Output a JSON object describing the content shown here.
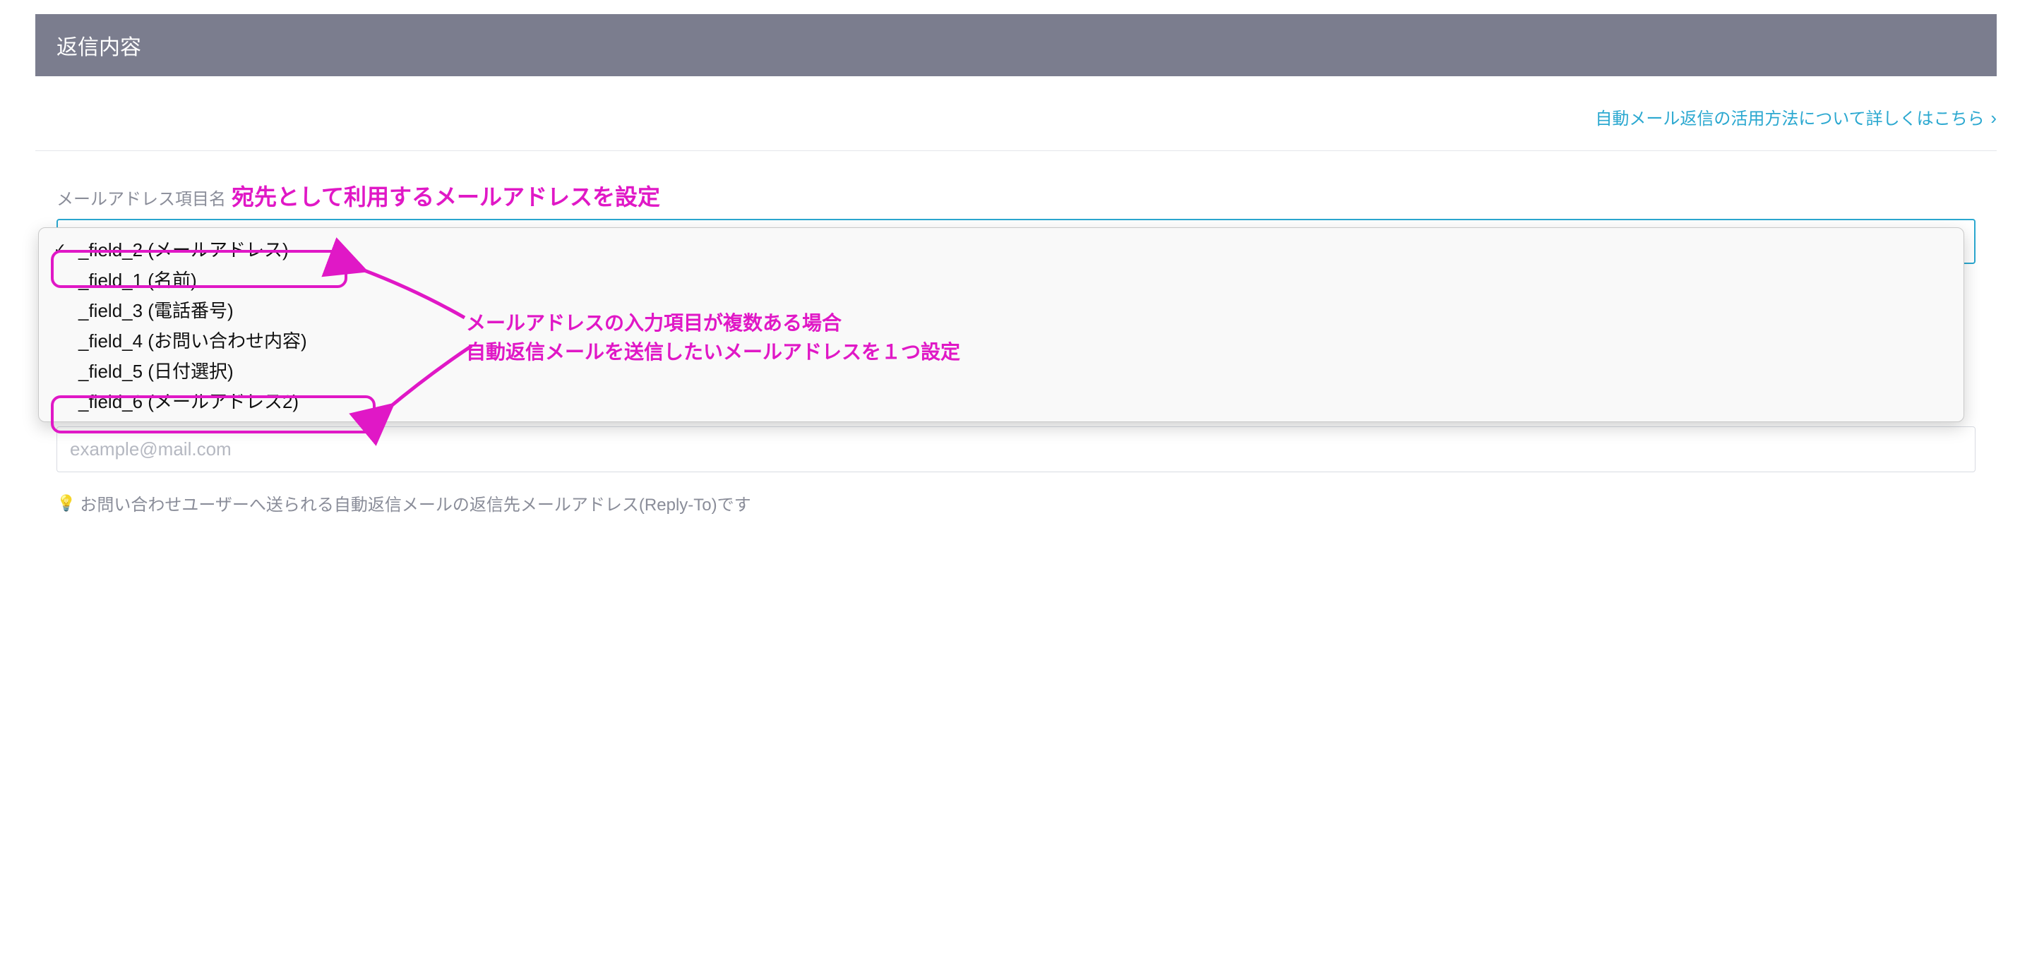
{
  "header": {
    "title": "返信内容"
  },
  "link": {
    "label": "自動メール返信の活用方法について詳しくはこちら"
  },
  "field": {
    "label": "メールアドレス項目名"
  },
  "annotation": {
    "title": "宛先として利用するメールアドレスを設定",
    "desc_line1": "メールアドレスの入力項目が複数ある場合",
    "desc_line2": "自動返信メールを送信したいメールアドレスを１つ設定"
  },
  "options": [
    {
      "label": "_field_2 (メールアドレス)",
      "selected": true
    },
    {
      "label": "_field_1 (名前)",
      "selected": false
    },
    {
      "label": "_field_3 (電話番号)",
      "selected": false
    },
    {
      "label": "_field_4 (お問い合わせ内容)",
      "selected": false
    },
    {
      "label": "_field_5 (日付選択)",
      "selected": false
    },
    {
      "label": "_field_6 (メールアドレス2)",
      "selected": false
    }
  ],
  "replyto": {
    "placeholder": "example@mail.com",
    "hint": "お問い合わせユーザーへ送られる自動返信メールの返信先メールアドレス(Reply-To)です"
  }
}
